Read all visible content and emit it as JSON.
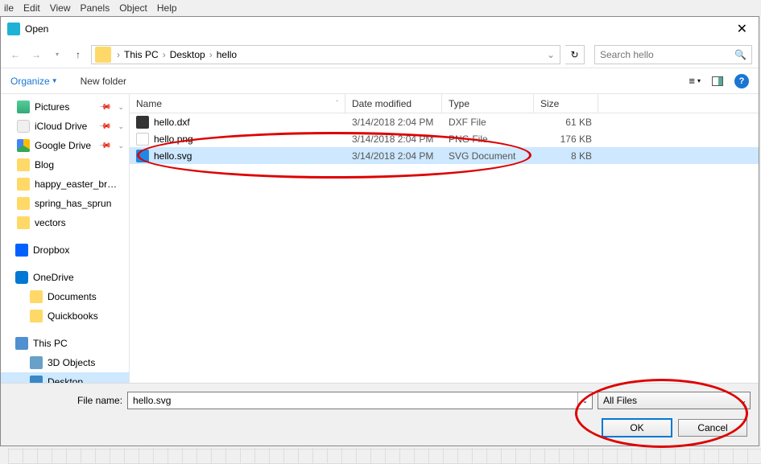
{
  "menubar": [
    "ile",
    "Edit",
    "View",
    "Panels",
    "Object",
    "Help"
  ],
  "dialog": {
    "title": "Open"
  },
  "breadcrumb": [
    "This PC",
    "Desktop",
    "hello"
  ],
  "search": {
    "placeholder": "Search hello"
  },
  "toolbar": {
    "organize": "Organize",
    "newfolder": "New folder"
  },
  "tree": [
    {
      "icon": "pictures",
      "label": "Pictures",
      "pin": true,
      "chev": true
    },
    {
      "icon": "icloud",
      "label": "iCloud Drive",
      "pin": true,
      "chev": true
    },
    {
      "icon": "gdrive",
      "label": "Google Drive",
      "pin": true,
      "chev": true
    },
    {
      "icon": "folder",
      "label": "Blog"
    },
    {
      "icon": "folder",
      "label": "happy_easter_br…"
    },
    {
      "icon": "folder",
      "label": "spring_has_sprun"
    },
    {
      "icon": "folder",
      "label": "vectors"
    },
    {
      "spacer": true
    },
    {
      "icon": "dropbox",
      "label": "Dropbox",
      "top": true
    },
    {
      "spacer": true
    },
    {
      "icon": "onedrive",
      "label": "OneDrive",
      "top": true
    },
    {
      "icon": "folder",
      "label": "Documents",
      "sub": true
    },
    {
      "icon": "folder",
      "label": "Quickbooks",
      "sub": true
    },
    {
      "spacer": true
    },
    {
      "icon": "pc",
      "label": "This PC",
      "top": true
    },
    {
      "icon": "obj",
      "label": "3D Objects",
      "sub": true
    },
    {
      "icon": "desktop",
      "label": "Desktop",
      "sub": true,
      "sel": true
    }
  ],
  "cols": {
    "name": "Name",
    "date": "Date modified",
    "type": "Type",
    "size": "Size"
  },
  "files": [
    {
      "icon": "dxf",
      "name": "hello.dxf",
      "date": "3/14/2018 2:04 PM",
      "type": "DXF File",
      "size": "61 KB"
    },
    {
      "icon": "png",
      "name": "hello.png",
      "date": "3/14/2018 2:04 PM",
      "type": "PNG File",
      "size": "176 KB"
    },
    {
      "icon": "svg",
      "name": "hello.svg",
      "date": "3/14/2018 2:04 PM",
      "type": "SVG Document",
      "size": "8 KB",
      "sel": true
    }
  ],
  "bottom": {
    "fnlabel": "File name:",
    "fnvalue": "hello.svg",
    "filetype": "All Files",
    "ok": "OK",
    "cancel": "Cancel"
  }
}
